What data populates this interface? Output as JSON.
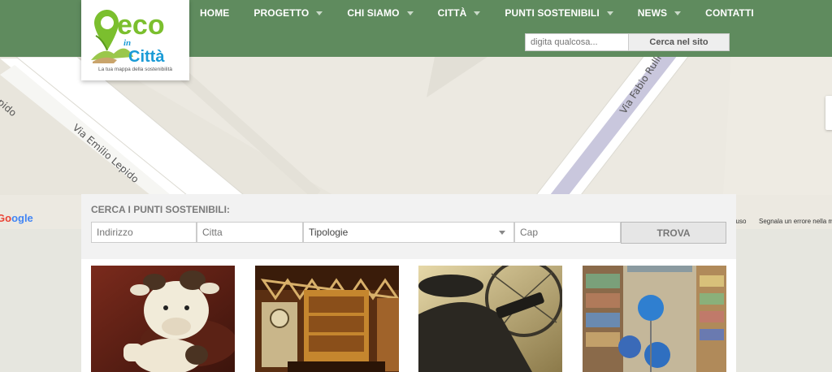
{
  "logo": {
    "word_eco": "eco",
    "word_in": "in",
    "word_citta": "Città",
    "tagline": "La tua mappa della sostenibilità"
  },
  "nav": {
    "items": [
      {
        "label": "HOME",
        "dropdown": false
      },
      {
        "label": "PROGETTO",
        "dropdown": true
      },
      {
        "label": "CHI SIAMO",
        "dropdown": true
      },
      {
        "label": "CITTÀ",
        "dropdown": true
      },
      {
        "label": "PUNTI SOSTENIBILI",
        "dropdown": true
      },
      {
        "label": "NEWS",
        "dropdown": true
      },
      {
        "label": "CONTATTI",
        "dropdown": false
      }
    ]
  },
  "site_search": {
    "placeholder": "digita qualcosa...",
    "button_label": "Cerca nel sito"
  },
  "map": {
    "streets": [
      "Via Emilio Lepido",
      "Via Fabio Rullia"
    ],
    "partial_label": "io Lepido",
    "google": "Google",
    "footer_left": "Condizioni d'uso",
    "footer_right": "Segnala un errore nella mappa",
    "pin_icon": "eco-map-pin-icon"
  },
  "search_panel": {
    "title": "CERCA I PUNTI SOSTENIBILI:",
    "address_placeholder": "Indirizzo",
    "city_placeholder": "Citta",
    "type_selected": "Tipologie",
    "cap_placeholder": "Cap",
    "button_label": "TROVA"
  },
  "cards": [
    {
      "image": "plush-cow-toy-photo"
    },
    {
      "image": "beer-shop-interior-photo"
    },
    {
      "image": "bicycle-pedal-photo"
    },
    {
      "image": "bookshop-globes-photo"
    }
  ],
  "colors": {
    "header_green": "#5f8b5e",
    "logo_green": "#7bbf2e",
    "logo_blue": "#1a9bd6",
    "pin_blue": "#2f98d0"
  }
}
